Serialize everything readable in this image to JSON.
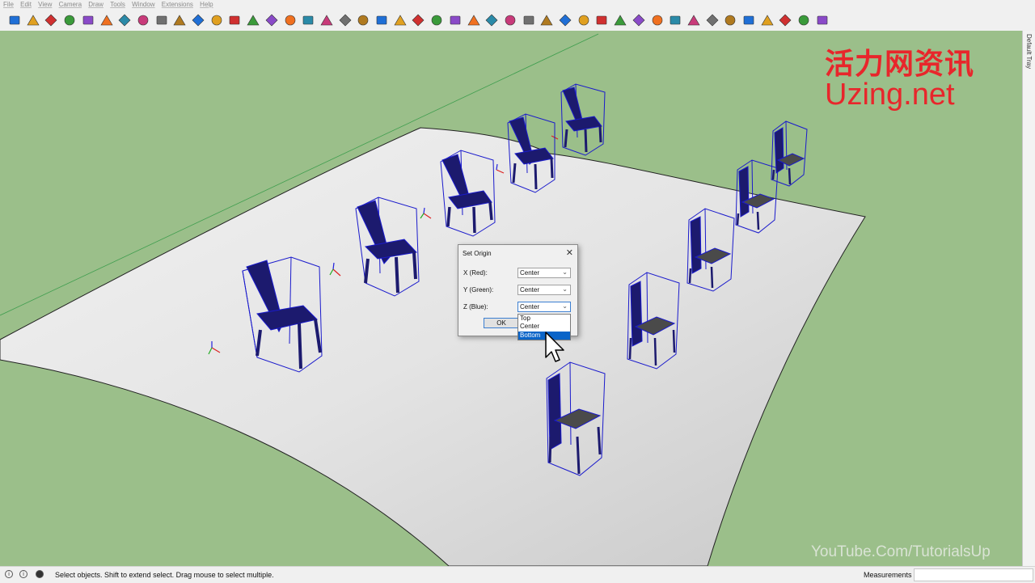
{
  "menu": [
    "File",
    "Edit",
    "View",
    "Camera",
    "Draw",
    "Tools",
    "Window",
    "Extensions",
    "Help"
  ],
  "toolbar": {
    "icons": [
      "select-icon",
      "eraser-icon",
      "paint-bucket-icon",
      "tag-icon",
      "component-icon",
      "box-icon",
      "orbit-icon",
      "push-pull-icon",
      "rotate-icon",
      "rectangle-icon",
      "line-icon",
      "freehand-icon",
      "follow-me-icon",
      "offset-icon",
      "arc-icon",
      "dots-icon",
      "move-icon",
      "add-icon",
      "scale-icon",
      "tape-icon",
      "protractor-icon",
      "dimension-icon",
      "text-icon",
      "axes-icon",
      "section-icon",
      "walk-icon",
      "look-icon",
      "zoom-icon",
      "zoom-extents-icon",
      "pan-icon",
      "undo-icon",
      "redo-icon",
      "solid-icon",
      "camera-icon",
      "plugin-icon",
      "layer-icon",
      "grid-icon",
      "table-icon",
      "chart-icon",
      "flag-icon",
      "fence-icon",
      "panel-icon",
      "swap-icon",
      "arc-tool-icon",
      "matrix-icon"
    ]
  },
  "tray": {
    "label": "Default Tray"
  },
  "watermark": {
    "line1": "活力网资讯",
    "line2": "Uzing.net",
    "youtube": "YouTube.Com/TutorialsUp"
  },
  "dialog": {
    "title": "Set Origin",
    "close": "✕",
    "x_label": "X (Red):",
    "x_value": "Center",
    "y_label": "Y (Green):",
    "y_value": "Center",
    "z_label": "Z (Blue):",
    "z_value": "Center",
    "ok_label": "OK"
  },
  "dropdown": {
    "options": [
      "Top",
      "Center",
      "Bottom"
    ],
    "selected": "Bottom"
  },
  "status": {
    "text": "Select objects. Shift to extend select. Drag mouse to select multiple.",
    "measurements_label": "Measurements",
    "measurements_value": ""
  },
  "colors": {
    "sky_ground": "#9bbf8a",
    "selection": "#1a1acc",
    "chair_dark": "#1c1a6e",
    "highlight": "#0a64c8",
    "watermark_red": "#e8262b"
  }
}
